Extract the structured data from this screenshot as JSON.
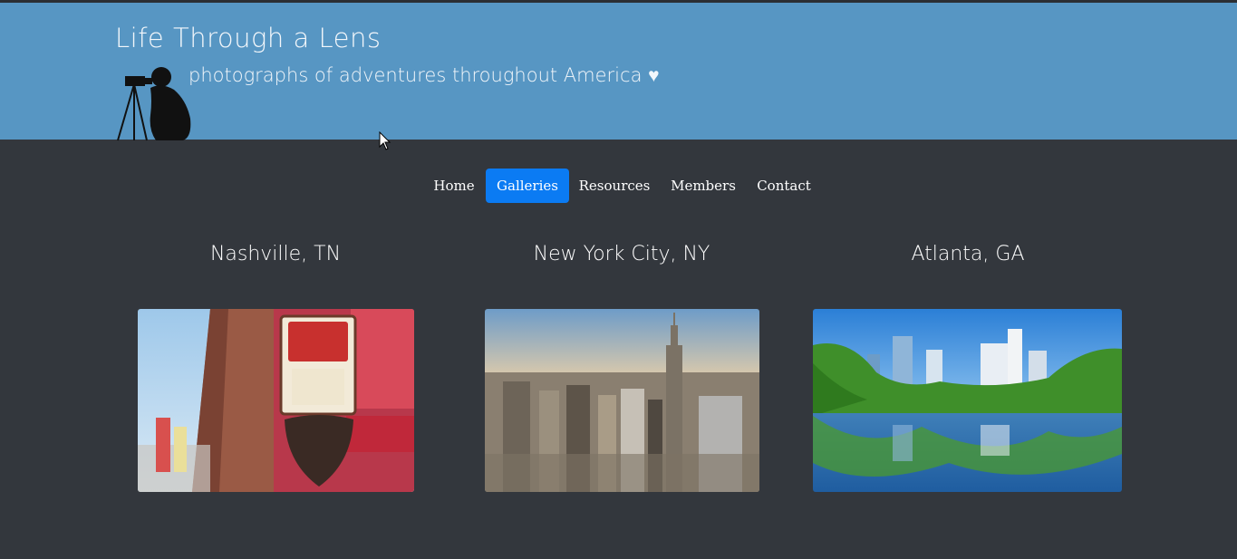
{
  "header": {
    "title": "Life Through a Lens",
    "subtitle": "photographs of adventures throughout America ♥",
    "logo_icon": "photographer-silhouette-icon"
  },
  "nav": {
    "items": [
      {
        "label": "Home"
      },
      {
        "label": "Galleries",
        "active": true
      },
      {
        "label": "Resources"
      },
      {
        "label": "Members"
      },
      {
        "label": "Contact"
      }
    ]
  },
  "galleries": [
    {
      "title": "Nashville, TN"
    },
    {
      "title": "New York City, NY"
    },
    {
      "title": "Atlanta, GA"
    }
  ],
  "colors": {
    "header_bg": "#5796c3",
    "page_bg": "#33373d",
    "nav_active": "#0b7bf3"
  }
}
